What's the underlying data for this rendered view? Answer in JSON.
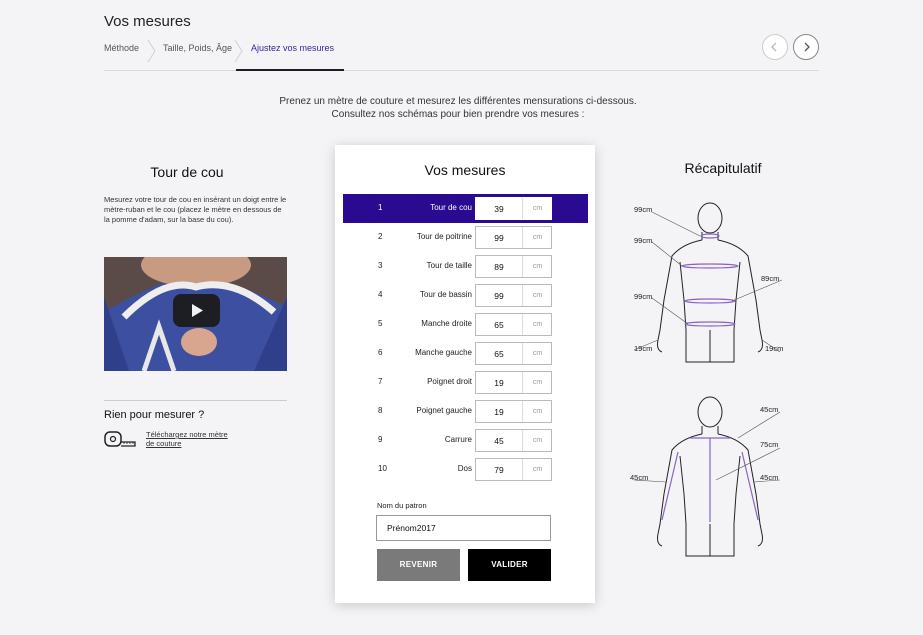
{
  "header": {
    "title": "Vos mesures",
    "breadcrumb": [
      "Méthode",
      "Taille, Poids, Âge",
      "Ajustez vos mesures"
    ]
  },
  "intro": {
    "line1": "Prenez un mètre de couture et mesurez les différentes mensurations ci-dessous.",
    "line2": "Consultez nos schémas pour bien prendre vos mesures :"
  },
  "left": {
    "heading": "Tour de cou",
    "text": "Mesurez votre tour de cou en insérant un doigt entre le mètre-ruban et le cou (placez le mètre en dessous de la pomme d'adam, sur la base du cou).",
    "no_tape_heading": "Rien pour mesurer ?",
    "download_link": "Téléchargez notre mètre de couture"
  },
  "card": {
    "title": "Vos mesures",
    "unit": "cm",
    "rows": [
      {
        "num": "1",
        "label": "Tour de cou",
        "value": "39"
      },
      {
        "num": "2",
        "label": "Tour de poitrine",
        "value": "99"
      },
      {
        "num": "3",
        "label": "Tour de taille",
        "value": "89"
      },
      {
        "num": "4",
        "label": "Tour de bassin",
        "value": "99"
      },
      {
        "num": "5",
        "label": "Manche droite",
        "value": "65"
      },
      {
        "num": "6",
        "label": "Manche gauche",
        "value": "65"
      },
      {
        "num": "7",
        "label": "Poignet droit",
        "value": "19"
      },
      {
        "num": "8",
        "label": "Poignet gauche",
        "value": "19"
      },
      {
        "num": "9",
        "label": "Carrure",
        "value": "45"
      },
      {
        "num": "10",
        "label": "Dos",
        "value": "79"
      }
    ],
    "pattern_label": "Nom du patron",
    "pattern_value": "Prénom2017",
    "back_label": "REVENIR",
    "submit_label": "VALIDER"
  },
  "summary": {
    "title": "Récapitulatif",
    "front": {
      "neck": "99cm",
      "chest": "99cm",
      "waist": "89cm",
      "hip": "99cm",
      "wrist_left": "19cm",
      "wrist_right": "19cm"
    },
    "back": {
      "sleeve_top": "45cm",
      "back_length": "75cm",
      "shoulder_left": "45cm",
      "sleeve_right": "45cm"
    }
  },
  "colors": {
    "accent": "#2a0a90",
    "background": "#f4f4f6"
  }
}
